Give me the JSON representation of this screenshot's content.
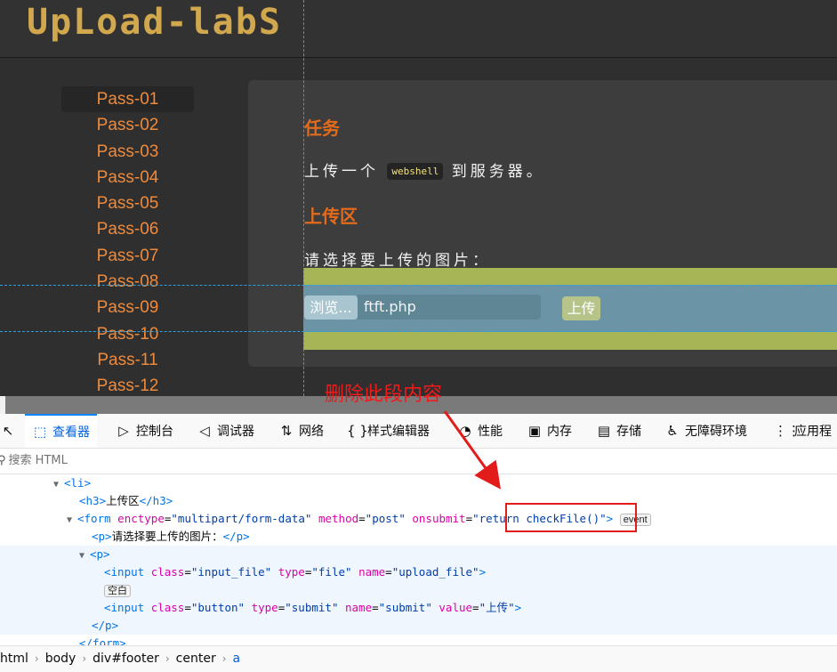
{
  "logo": "UpLoad-labS",
  "menu": [
    "Pass-01",
    "Pass-02",
    "Pass-03",
    "Pass-04",
    "Pass-05",
    "Pass-06",
    "Pass-07",
    "Pass-08",
    "Pass-09",
    "Pass-10",
    "Pass-11",
    "Pass-12"
  ],
  "content": {
    "task_heading": "任务",
    "task_prefix": "上传一个",
    "task_code": "webshell",
    "task_suffix": "到服务器。",
    "upload_heading": "上传区",
    "choose_text": "请选择要上传的图片：",
    "browse_label": "浏览...",
    "file_name": "ftft.php",
    "submit_label": "上传"
  },
  "annotation": "删除此段内容",
  "devtools": {
    "tabs": [
      {
        "icon": "⬚",
        "label": "查看器"
      },
      {
        "icon": "▷",
        "label": "控制台"
      },
      {
        "icon": "◁",
        "label": "调试器"
      },
      {
        "icon": "⇅",
        "label": "网络"
      },
      {
        "icon": "{ }",
        "label": "样式编辑器"
      },
      {
        "icon": "◔",
        "label": "性能"
      },
      {
        "icon": "▣",
        "label": "内存"
      },
      {
        "icon": "▤",
        "label": "存储"
      },
      {
        "icon": "♿",
        "label": "无障碍环境"
      },
      {
        "icon": "⋮⋮",
        "label": "应用程"
      }
    ],
    "search_placeholder": "搜索 HTML",
    "nodes": {
      "li": "li",
      "h3_text": "上传区",
      "form_enctype": "multipart/form-data",
      "form_method": "post",
      "form_onsubmit": "return checkFile()",
      "event_badge": "event",
      "p_text": "请选择要上传的图片：",
      "whitespace_badge": "空白",
      "input1_class": "input_file",
      "input1_type": "file",
      "input1_name": "upload_file",
      "input2_class": "button",
      "input2_type": "submit",
      "input2_name": "submit",
      "input2_value": "上传"
    },
    "breadcrumbs": [
      "html",
      "body",
      "div#footer",
      "center",
      "a"
    ]
  },
  "colors": {
    "menu_text": "#f08a3a",
    "heading": "#e36b1b",
    "logo": "#d2a84f",
    "annotation": "#f11a1a",
    "devtools_accent": "#0060df"
  }
}
